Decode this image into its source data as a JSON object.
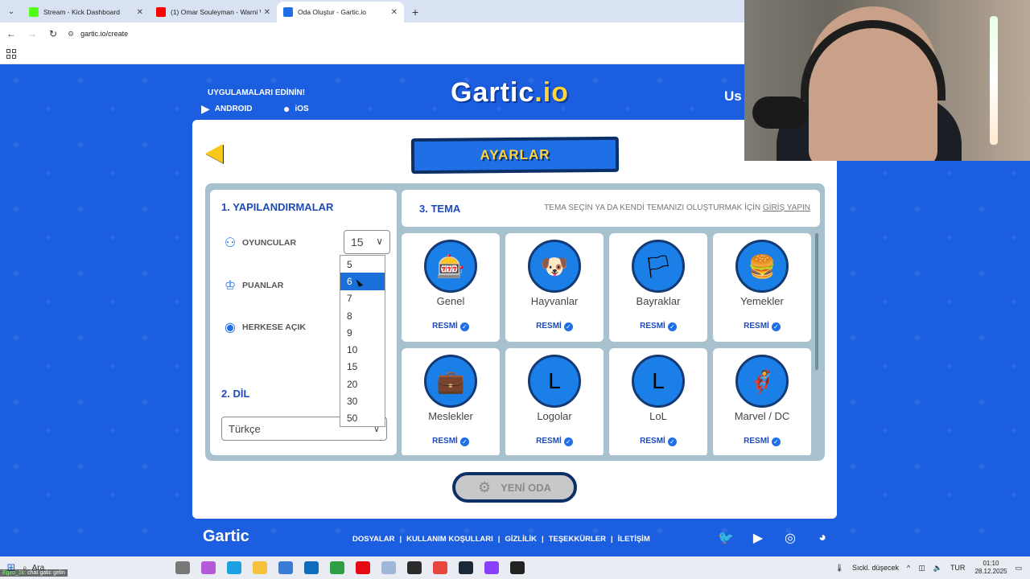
{
  "browser": {
    "tabs": [
      {
        "title": "Stream - Kick Dashboard",
        "favicon_color": "#53fc18",
        "active": false
      },
      {
        "title": "(1) Omar Souleyman - Warni W",
        "favicon_color": "#ff0000",
        "active": false
      },
      {
        "title": "Oda Oluştur - Gartic.io",
        "favicon_color": "#1f6fe6",
        "active": true
      }
    ],
    "url": "gartic.io/create"
  },
  "header": {
    "get_apps": "UYGULAMALARI EDİNİN!",
    "android": "ANDROID",
    "ios": "iOS",
    "logo_main": "Gartic",
    "logo_accent": ".io",
    "user_cut": "Us"
  },
  "panel": {
    "ribbon_title": "AYARLAR",
    "config": {
      "title": "1. YAPILANDIRMALAR",
      "players_label": "OYUNCULAR",
      "players_value": "15",
      "points_label": "PUANLAR",
      "public_label": "HERKESE AÇIK"
    },
    "language": {
      "title": "2. DİL",
      "value": "Türkçe"
    },
    "dropdown": {
      "options": [
        "5",
        "6",
        "7",
        "8",
        "9",
        "10",
        "15",
        "20",
        "30",
        "50"
      ],
      "highlighted": "6"
    },
    "theme": {
      "title": "3. TEMA",
      "hint_text": "TEMA SEÇİN YA DA KENDİ TEMANIZI OLUŞTURMAK İÇİN",
      "hint_link": "GİRİŞ YAPIN",
      "badge": "RESMİ",
      "cards": [
        {
          "name": "Genel",
          "icon": "slot-machine-icon",
          "glyph": "🎰"
        },
        {
          "name": "Hayvanlar",
          "icon": "corgi-icon",
          "glyph": "🐶"
        },
        {
          "name": "Bayraklar",
          "icon": "flag-icon",
          "glyph": "🏳"
        },
        {
          "name": "Yemekler",
          "icon": "burger-icon",
          "glyph": "🍔"
        },
        {
          "name": "Meslekler",
          "icon": "briefcase-icon",
          "glyph": "💼"
        },
        {
          "name": "Logolar",
          "icon": "logo-icon",
          "glyph": "L"
        },
        {
          "name": "LoL",
          "icon": "lol-icon",
          "glyph": "L"
        },
        {
          "name": "Marvel / DC",
          "icon": "hero-mask-icon",
          "glyph": "🦸"
        }
      ]
    },
    "new_room": "YENİ ODA"
  },
  "footer": {
    "logo": "Gartic",
    "links": [
      "DOSYALAR",
      "KULLANIM KOŞULLARI",
      "GİZLİLİK",
      "TEŞEKKÜRLER",
      "İLETİŞİM"
    ]
  },
  "taskbar": {
    "search": "Ara",
    "chat_overlay_user": "Egzo_1k:",
    "chat_overlay_text": "chat gatic gelin",
    "weather": "Sıckl. düşecek",
    "lang": "TUR",
    "time": "01:10",
    "date": "28.12.2025"
  }
}
